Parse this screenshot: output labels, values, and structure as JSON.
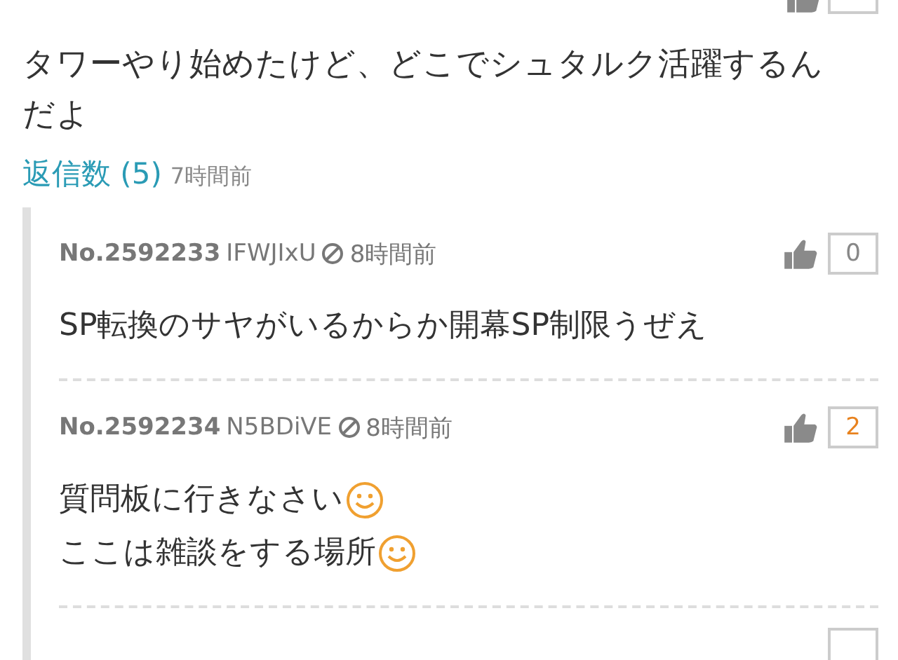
{
  "post": {
    "body": [
      "タワーやり始めたけど、どこでシュタルク活躍するんだよ"
    ],
    "replies_link": "返信数 (5)",
    "time": "7時間前"
  },
  "replies": [
    {
      "number": "No.2592233",
      "user_id": "IFWJIxU",
      "time": "8時間前",
      "likes": "0",
      "liked": false,
      "lines": [
        {
          "text": "SP転換のサヤがいるからか開幕SP制限うぜえ",
          "emoji": false
        }
      ]
    },
    {
      "number": "No.2592234",
      "user_id": "N5BDiVE",
      "time": "8時間前",
      "likes": "2",
      "liked": true,
      "lines": [
        {
          "text": "質問板に行きなさい",
          "emoji": true
        },
        {
          "text": "ここは雑談をする場所",
          "emoji": true
        }
      ]
    }
  ]
}
